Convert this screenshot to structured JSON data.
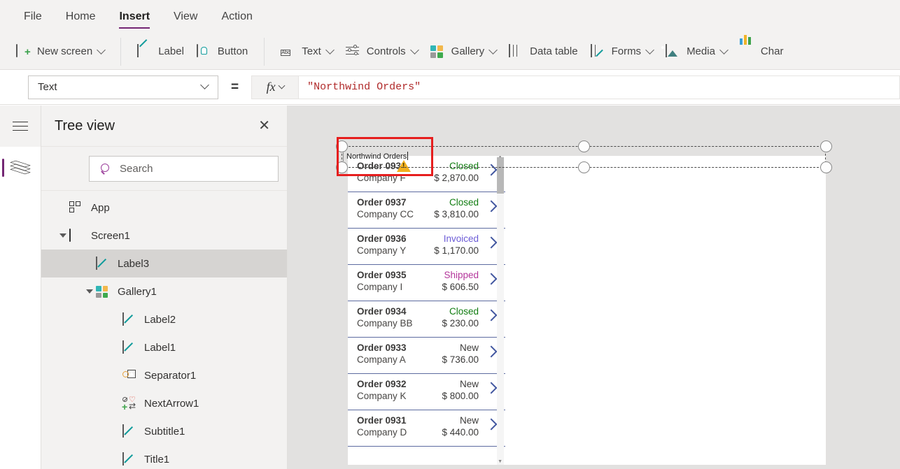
{
  "menu": {
    "items": [
      {
        "label": "File",
        "active": false
      },
      {
        "label": "Home",
        "active": false
      },
      {
        "label": "Insert",
        "active": true
      },
      {
        "label": "View",
        "active": false
      },
      {
        "label": "Action",
        "active": false
      }
    ]
  },
  "ribbon": {
    "groups": [
      {
        "items": [
          {
            "label": "New screen",
            "icon": "new-screen-icon",
            "caret": true
          }
        ]
      },
      {
        "items": [
          {
            "label": "Label",
            "icon": "label-icon",
            "caret": false
          },
          {
            "label": "Button",
            "icon": "button-icon",
            "caret": false
          }
        ]
      },
      {
        "items": [
          {
            "label": "Text",
            "icon": "text-abc-icon",
            "caret": true
          },
          {
            "label": "Controls",
            "icon": "controls-sliders-icon",
            "caret": true
          },
          {
            "label": "Gallery",
            "icon": "gallery-grid-icon",
            "caret": true
          },
          {
            "label": "Data table",
            "icon": "data-table-icon",
            "caret": false
          },
          {
            "label": "Forms",
            "icon": "forms-icon",
            "caret": true
          },
          {
            "label": "Media",
            "icon": "media-image-icon",
            "caret": true
          },
          {
            "label": "Char",
            "icon": "chart-bars-icon",
            "caret": false
          }
        ]
      }
    ]
  },
  "formula_bar": {
    "property": "Text",
    "equals": "=",
    "fx": "fx",
    "formula": "\"Northwind Orders\""
  },
  "rail": {
    "hamburger": "hamburger-menu-icon",
    "items": [
      {
        "name": "tree-view-layers-icon",
        "active": true
      }
    ]
  },
  "tree_view": {
    "title": "Tree view",
    "close": "✕",
    "search_placeholder": "Search",
    "nodes": [
      {
        "label": "App",
        "icon": "app-icon",
        "indent": 0,
        "expander": "none",
        "selected": false
      },
      {
        "label": "Screen1",
        "icon": "screen-icon",
        "indent": 0,
        "expander": "open",
        "selected": false
      },
      {
        "label": "Label3",
        "icon": "label-icon",
        "indent": 1,
        "expander": "none",
        "selected": true
      },
      {
        "label": "Gallery1",
        "icon": "gallery-icon",
        "indent": 1,
        "expander": "open",
        "selected": false
      },
      {
        "label": "Label2",
        "icon": "label-icon",
        "indent": 2,
        "expander": "none",
        "selected": false
      },
      {
        "label": "Label1",
        "icon": "label-icon",
        "indent": 2,
        "expander": "none",
        "selected": false
      },
      {
        "label": "Separator1",
        "icon": "separator-icon",
        "indent": 2,
        "expander": "none",
        "selected": false
      },
      {
        "label": "NextArrow1",
        "icon": "next-arrow-icon",
        "indent": 2,
        "expander": "none",
        "selected": false
      },
      {
        "label": "Subtitle1",
        "icon": "label-icon",
        "indent": 2,
        "expander": "none",
        "selected": false
      },
      {
        "label": "Title1",
        "icon": "label-icon",
        "indent": 2,
        "expander": "none",
        "selected": false
      }
    ]
  },
  "canvas": {
    "selected_label": {
      "text": "Northwind Orders",
      "has_text_cursor": true,
      "handle_count": 6
    },
    "gallery": {
      "scrollbar_up": "▲",
      "scrollbar_down": "▼",
      "items": [
        {
          "title": "Order 0938",
          "company": "Company F",
          "status": "Closed",
          "amount": "$ 2,870.00",
          "status_color": "#107c10",
          "warning": true
        },
        {
          "title": "Order 0937",
          "company": "Company CC",
          "status": "Closed",
          "amount": "$ 3,810.00",
          "status_color": "#107c10",
          "warning": false
        },
        {
          "title": "Order 0936",
          "company": "Company Y",
          "status": "Invoiced",
          "amount": "$ 1,170.00",
          "status_color": "#6b5bd6",
          "warning": false
        },
        {
          "title": "Order 0935",
          "company": "Company I",
          "status": "Shipped",
          "amount": "$ 606.50",
          "status_color": "#b4359b",
          "warning": false
        },
        {
          "title": "Order 0934",
          "company": "Company BB",
          "status": "Closed",
          "amount": "$ 230.00",
          "status_color": "#107c10",
          "warning": false
        },
        {
          "title": "Order 0933",
          "company": "Company A",
          "status": "New",
          "amount": "$ 736.00",
          "status_color": "#3b3a39",
          "warning": false
        },
        {
          "title": "Order 0932",
          "company": "Company K",
          "status": "New",
          "amount": "$ 800.00",
          "status_color": "#3b3a39",
          "warning": false
        },
        {
          "title": "Order 0931",
          "company": "Company D",
          "status": "New",
          "amount": "$ 440.00",
          "status_color": "#3b3a39",
          "warning": false
        }
      ]
    }
  },
  "colors": {
    "accent_purple": "#742774",
    "chrome_gray": "#f3f2f1",
    "canvas_gray": "#e2e1e0",
    "selection_red": "#e61e1e",
    "chevron_blue": "#4257a0",
    "warning_amber": "#f2b01e"
  }
}
